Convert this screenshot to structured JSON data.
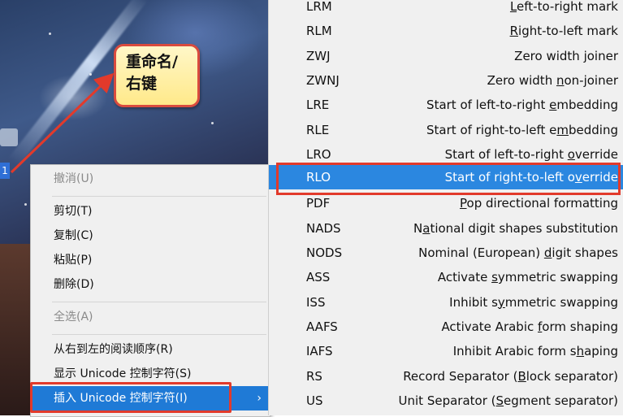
{
  "callout": {
    "text": "重命名/\n右键"
  },
  "desktop": {
    "selected_file_label": "1"
  },
  "context_menu": {
    "items": [
      {
        "label": "撤消(U)",
        "disabled": true
      },
      {
        "label": "剪切(T)",
        "disabled": false
      },
      {
        "label": "复制(C)",
        "disabled": false
      },
      {
        "label": "粘贴(P)",
        "disabled": false
      },
      {
        "label": "删除(D)",
        "disabled": false
      },
      {
        "label": "全选(A)",
        "disabled": true
      },
      {
        "label": "从右到左的阅读顺序(R)",
        "disabled": false
      },
      {
        "label": "显示 Unicode 控制字符(S)",
        "disabled": false
      },
      {
        "label": "插入 Unicode 控制字符(I)",
        "disabled": false,
        "active": true
      }
    ],
    "submenu_arrow": "›"
  },
  "unicode_submenu": {
    "items": [
      {
        "code": "LRM",
        "pre": "",
        "u": "L",
        "post": "eft-to-right mark"
      },
      {
        "code": "RLM",
        "pre": "",
        "u": "R",
        "post": "ight-to-left mark"
      },
      {
        "code": "ZWJ",
        "pre": "Zero width ",
        "u": "j",
        "post": "oiner"
      },
      {
        "code": "ZWNJ",
        "pre": "Zero width ",
        "u": "n",
        "post": "on-joiner"
      },
      {
        "code": "LRE",
        "pre": "Start of left-to-right ",
        "u": "e",
        "post": "mbedding"
      },
      {
        "code": "RLE",
        "pre": "Start of right-to-left e",
        "u": "m",
        "post": "bedding"
      },
      {
        "code": "LRO",
        "pre": "Start of left-to-right ",
        "u": "o",
        "post": "verride"
      },
      {
        "code": "RLO",
        "pre": "Start of right-to-left o",
        "u": "v",
        "post": "erride",
        "highlight": true
      },
      {
        "code": "PDF",
        "pre": "",
        "u": "P",
        "post": "op directional formatting"
      },
      {
        "code": "NADS",
        "pre": "N",
        "u": "a",
        "post": "tional digit shapes substitution"
      },
      {
        "code": "NODS",
        "pre": "Nominal (European) ",
        "u": "d",
        "post": "igit shapes"
      },
      {
        "code": "ASS",
        "pre": "Activate ",
        "u": "s",
        "post": "ymmetric swapping"
      },
      {
        "code": "ISS",
        "pre": "Inhibit s",
        "u": "y",
        "post": "mmetric swapping"
      },
      {
        "code": "AAFS",
        "pre": "Activate Arabic ",
        "u": "f",
        "post": "orm shaping"
      },
      {
        "code": "IAFS",
        "pre": "Inhibit Arabic form s",
        "u": "h",
        "post": "aping"
      },
      {
        "code": "RS",
        "pre": "Record Separator (",
        "u": "B",
        "post": "lock separator)"
      },
      {
        "code": "US",
        "pre": "Unit Separator (",
        "u": "S",
        "post": "egment separator)"
      }
    ]
  },
  "colors": {
    "menu_highlight": "#1f7ad6",
    "submenu_highlight": "#2b87e0",
    "annotation_red": "#e23a2b",
    "callout_fill": "#ffe98a"
  }
}
